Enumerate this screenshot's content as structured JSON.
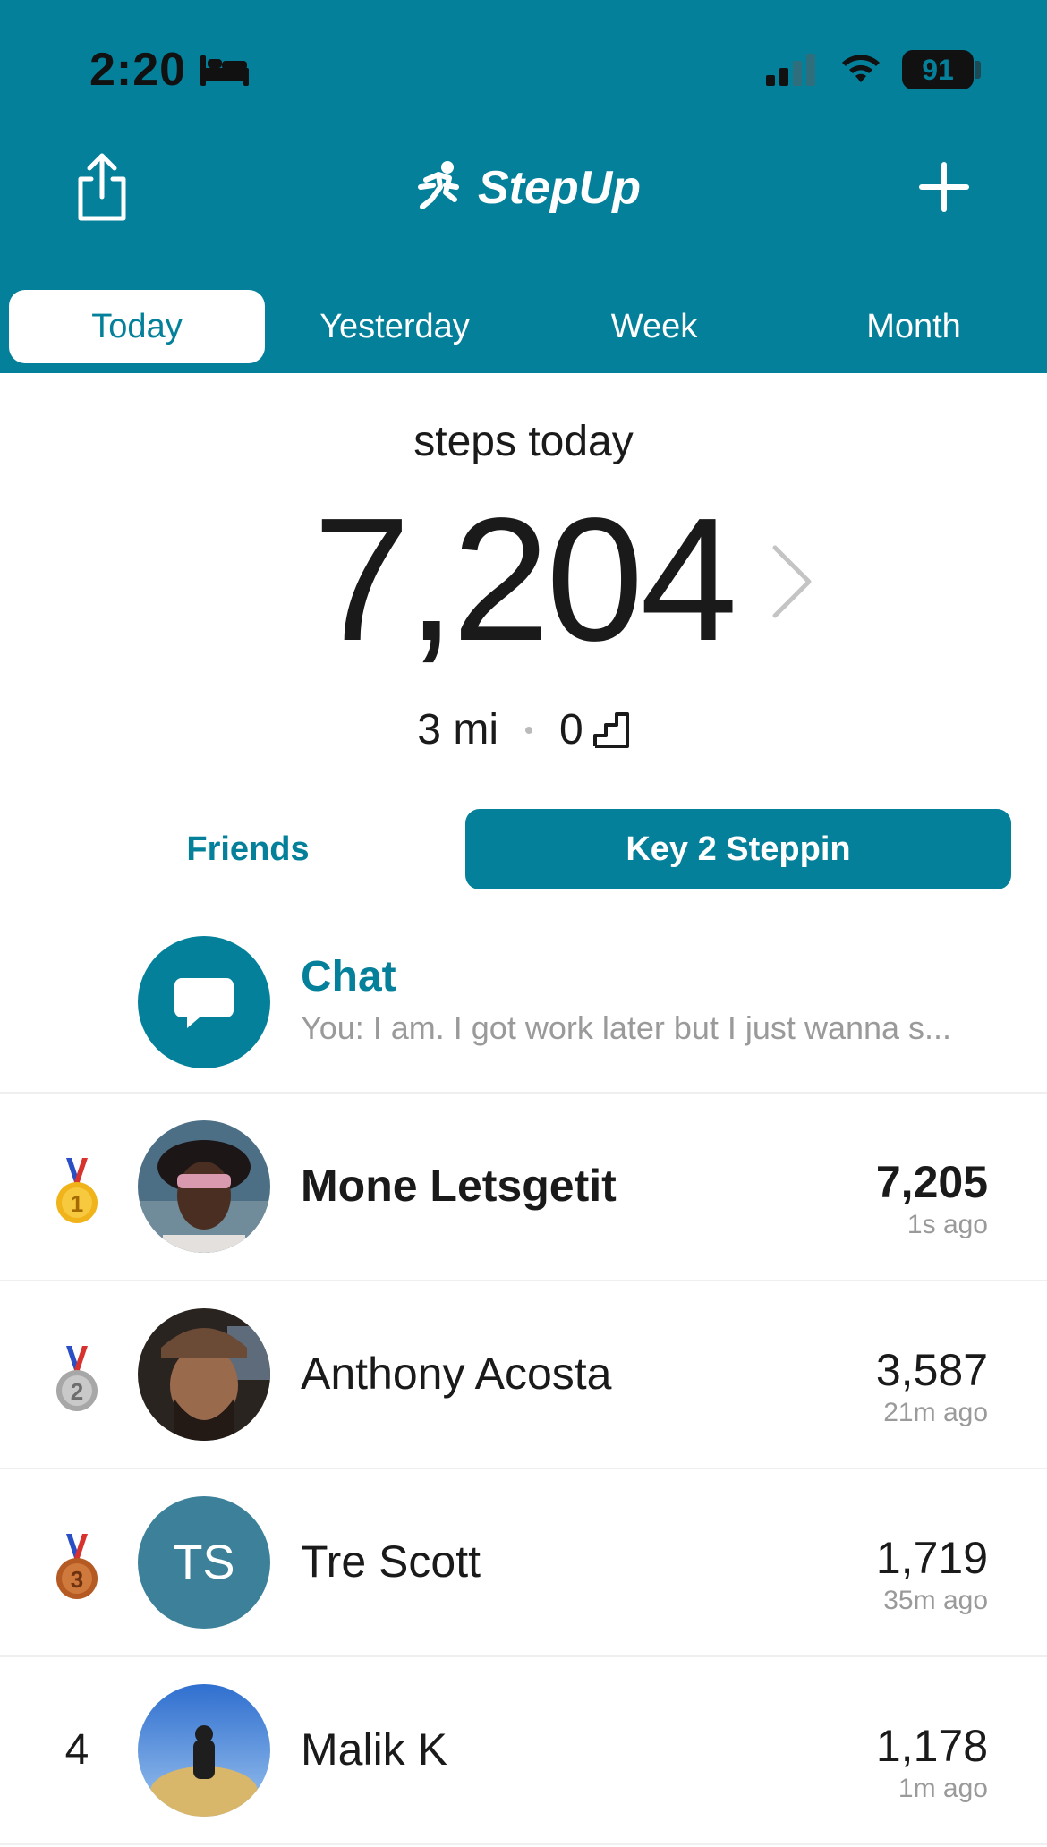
{
  "status_bar": {
    "time": "2:20",
    "battery": "91"
  },
  "header": {
    "app_name": "StepUp"
  },
  "period_tabs": [
    "Today",
    "Yesterday",
    "Week",
    "Month"
  ],
  "summary": {
    "label": "steps today",
    "steps": "7,204",
    "distance": "3 mi",
    "floors": "0"
  },
  "group_tabs": {
    "friends": "Friends",
    "group": "Key 2 Steppin"
  },
  "chat": {
    "title": "Chat",
    "preview": "You: I am. I got work later but I just wanna s..."
  },
  "leaderboard": [
    {
      "rank": "1",
      "name": "Mone Letsgetit",
      "steps": "7,205",
      "ago": "1s ago"
    },
    {
      "rank": "2",
      "name": "Anthony Acosta",
      "steps": "3,587",
      "ago": "21m ago"
    },
    {
      "rank": "3",
      "name": "Tre Scott",
      "initials": "TS",
      "steps": "1,719",
      "ago": "35m ago"
    },
    {
      "rank": "4",
      "name": "Malik K",
      "steps": "1,178",
      "ago": "1m ago"
    }
  ],
  "colors": {
    "brand": "#05809a",
    "gold": "#f0b31a",
    "silver": "#a7a7a7",
    "bronze": "#b45a22"
  }
}
